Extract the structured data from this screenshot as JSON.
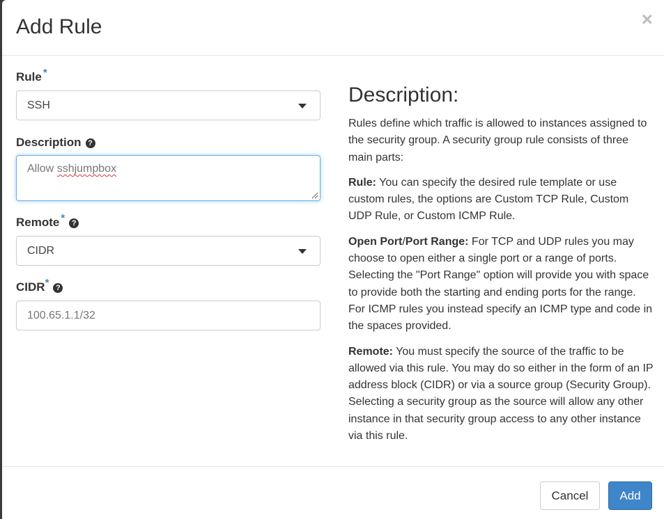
{
  "dialog": {
    "title": "Add Rule",
    "close_glyph": "×"
  },
  "form": {
    "rule": {
      "label": "Rule",
      "required_mark": "*",
      "value": "SSH"
    },
    "description": {
      "label": "Description",
      "help_glyph": "?",
      "value_prefix": "Allow ",
      "value_misspelled": "sshjumpbox"
    },
    "remote": {
      "label": "Remote",
      "required_mark": "*",
      "help_glyph": "?",
      "value": "CIDR"
    },
    "cidr": {
      "label": "CIDR",
      "required_mark": "*",
      "help_glyph": "?",
      "value": "100.65.1.1/32"
    }
  },
  "help_panel": {
    "title": "Description:",
    "intro": "Rules define which traffic is allowed to instances assigned to the security group. A security group rule consists of three main parts:",
    "rule_term": "Rule:",
    "rule_text": " You can specify the desired rule template or use custom rules, the options are Custom TCP Rule, Custom UDP Rule, or Custom ICMP Rule.",
    "port_term": "Open Port",
    "port_sep": "/",
    "port_term2": "Port Range:",
    "port_text": " For TCP and UDP rules you may choose to open either a single port or a range of ports. Selecting the \"Port Range\" option will provide you with space to provide both the starting and ending ports for the range. For ICMP rules you instead specify an ICMP type and code in the spaces provided.",
    "remote_term": "Remote:",
    "remote_text": " You must specify the source of the traffic to be allowed via this rule. You may do so either in the form of an IP address block (CIDR) or via a source group (Security Group). Selecting a security group as the source will allow any other instance in that security group access to any other instance via this rule."
  },
  "footer": {
    "cancel_label": "Cancel",
    "add_label": "Add"
  },
  "colors": {
    "primary": "#3f85c9",
    "required": "#3f85c9",
    "focus_border": "#66afe9"
  }
}
